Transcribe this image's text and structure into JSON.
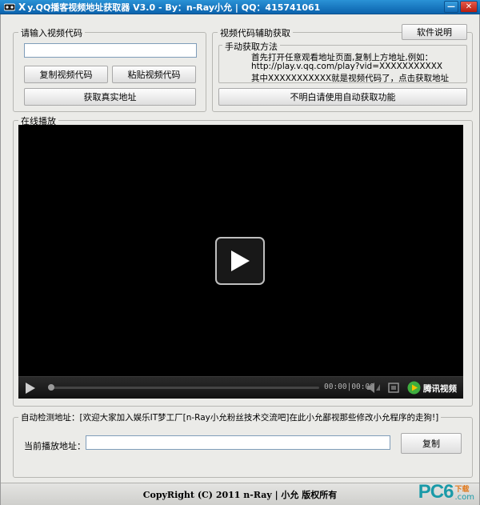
{
  "window": {
    "title": "y.QQ播客视频地址获取器 V3.0  - By：n-Ray小允 | QQ：415741061",
    "minimize_glyph": "—",
    "close_glyph": "✕"
  },
  "input_group": {
    "title": "请输入视频代码",
    "code_value": "",
    "copy_label": "复制视频代码",
    "paste_label": "粘贴视频代码",
    "get_label": "获取真实地址"
  },
  "helper_group": {
    "title": "视频代码辅助获取",
    "about_label": "软件说明",
    "manual_title": "手动获取方法",
    "line1": "首先打开任意观看地址页面,复制上方地址,例如：",
    "line2": "http://play.v.qq.com/play?vid=XXXXXXXXXXX",
    "line3": "其中XXXXXXXXXXX就是视频代码了，点击获取地址",
    "auto_label": "不明白请使用自动获取功能"
  },
  "player_group": {
    "title": "在线播放",
    "time_text": "00:00|00:00",
    "brand_text": "腾讯视频"
  },
  "detect_group": {
    "title": "自动检测地址：[欢迎大家加入娱乐IT梦工厂[n-Ray小允粉丝技术交流吧]在此小允鄙视那些修改小允程序的走狗!]",
    "current_label": "当前播放地址：",
    "current_value": "",
    "copy_label": "复制"
  },
  "footer": {
    "copyright": "CopyRight (C) 2011 n-Ray | 小允 版权所有"
  },
  "watermark": {
    "text": "PC6",
    "sub": "下载",
    "domain": ".com"
  },
  "colors": {
    "title_bar": "#0b63ad",
    "brand_green": "#3fae3f",
    "watermark_teal": "#1a9aa8"
  }
}
